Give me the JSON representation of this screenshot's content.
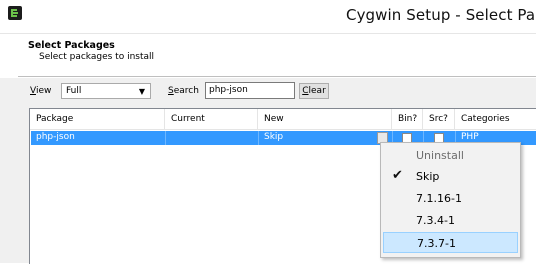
{
  "window": {
    "title": "Cygwin Setup - Select Pac"
  },
  "header": {
    "title": "Select Packages",
    "subtitle": "Select packages to install"
  },
  "toolbar": {
    "view_label": "View",
    "view_value": "Full",
    "search_label": "Search",
    "search_value": "php-json",
    "clear_label": "Clear"
  },
  "table": {
    "columns": [
      "Package",
      "Current",
      "New",
      "Bin?",
      "Src?",
      "Categories"
    ],
    "rows": [
      {
        "package": "php-json",
        "current": "",
        "new": "Skip",
        "categories": "PHP"
      }
    ]
  },
  "popup": {
    "items": [
      {
        "label": "Uninstall",
        "disabled": true,
        "checked": false,
        "hovered": false
      },
      {
        "label": "Skip",
        "disabled": false,
        "checked": true,
        "hovered": false
      },
      {
        "label": "7.1.16-1",
        "disabled": false,
        "checked": false,
        "hovered": false
      },
      {
        "label": "7.3.4-1",
        "disabled": false,
        "checked": false,
        "hovered": false
      },
      {
        "label": "7.3.7-1",
        "disabled": false,
        "checked": false,
        "hovered": true
      }
    ]
  },
  "colors": {
    "selection": "#3399ff",
    "menu_hover": "#cce8ff"
  }
}
